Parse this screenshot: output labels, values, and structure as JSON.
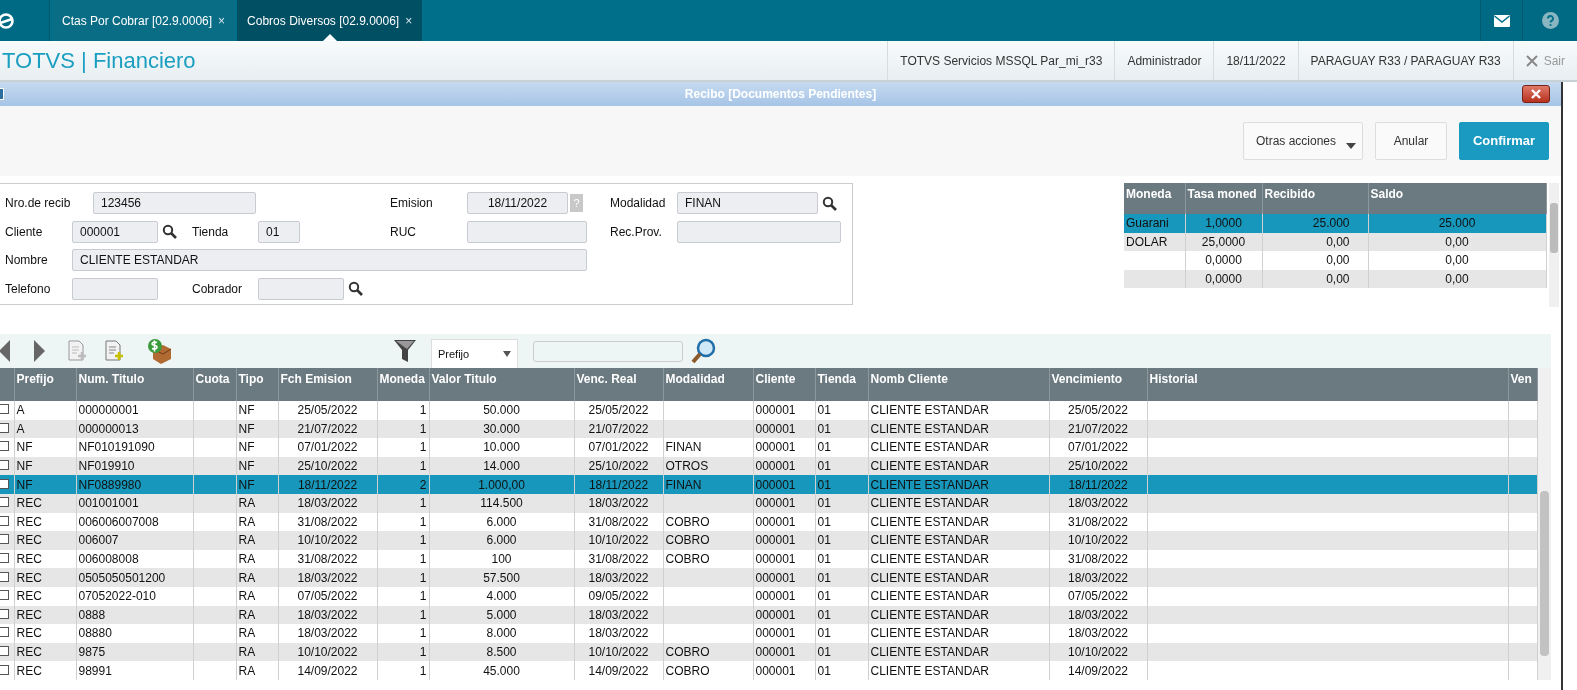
{
  "tabs": [
    {
      "label": "Ctas Por Cobrar [02.9.0006]",
      "close": "×",
      "selected": false
    },
    {
      "label": "Cobros Diversos [02.9.0006]",
      "close": "×",
      "selected": true
    }
  ],
  "app_title": "TOTVS | Financiero",
  "session_info": [
    "TOTVS Servicios MSSQL Par_mi_r33",
    "Administrador",
    "18/11/2022",
    "PARAGUAY R33 / PARAGUAY R33"
  ],
  "exit_label": "Sair",
  "dialog": {
    "title": "Recibo [Documentos Pendientes]"
  },
  "actions": [
    {
      "label": "Otras acciones",
      "kind": "menu"
    },
    {
      "label": "Anular",
      "kind": "plain"
    },
    {
      "label": "Confirmar",
      "kind": "primary"
    }
  ],
  "form": {
    "fields": [
      {
        "label": "Nro.de recib",
        "value": "123456",
        "lookup": false
      },
      {
        "label": "Emision",
        "value": "18/11/2022",
        "lookup": false,
        "help": "?"
      },
      {
        "label": "Modalidad",
        "value": "FINAN",
        "lookup": true
      },
      {
        "label": "Cliente",
        "value": "000001",
        "lookup": true
      },
      {
        "label": "Tienda",
        "value": "01",
        "lookup": false
      },
      {
        "label": "RUC",
        "lookup": false
      },
      {
        "label": "Rec.Prov.",
        "lookup": false
      },
      {
        "label": "Nombre",
        "value": "CLIENTE ESTANDAR",
        "lookup": false
      },
      {
        "label": "Telefono",
        "lookup": false
      },
      {
        "label": "Cobrador",
        "lookup": true
      }
    ]
  },
  "currency_table": {
    "columns": [
      "Moneda",
      "Tasa moned",
      "Recibido",
      "Saldo"
    ],
    "rows": [
      {
        "selected": true,
        "cells": [
          "Guarani",
          "1,0000",
          "25.000",
          "25.000"
        ]
      },
      {
        "selected": false,
        "cells": [
          "DOLAR",
          "25,0000",
          "0,00",
          "0,00"
        ]
      },
      {
        "selected": false,
        "cells": [
          null,
          "0,0000",
          "0,00",
          "0,00"
        ]
      },
      {
        "selected": false,
        "cells": [
          null,
          "0,0000",
          "0,00",
          "0,00"
        ]
      }
    ]
  },
  "toolbar": {
    "filter_field": {
      "value": "Prefijo"
    }
  },
  "table": {
    "columns": [
      "Prefijo",
      "Num. Titulo",
      "Cuota",
      "Tipo",
      "Fch Emision",
      "Moneda",
      "Valor Titulo",
      "Venc. Real",
      "Modalidad",
      "Cliente",
      "Tienda",
      "Nomb Cliente",
      "Vencimiento",
      "Historial",
      "Ven"
    ],
    "rows": [
      {
        "checked": false,
        "selected": false,
        "cells": [
          "A",
          "000000001",
          null,
          "NF",
          "25/05/2022",
          "1",
          "50.000",
          "25/05/2022",
          null,
          "000001",
          "01",
          "CLIENTE ESTANDAR",
          "25/05/2022"
        ]
      },
      {
        "checked": false,
        "selected": false,
        "cells": [
          "A",
          "000000013",
          null,
          "NF",
          "21/07/2022",
          "1",
          "30.000",
          "21/07/2022",
          null,
          "000001",
          "01",
          "CLIENTE ESTANDAR",
          "21/07/2022"
        ]
      },
      {
        "checked": false,
        "selected": false,
        "cells": [
          "NF",
          "NF010191090",
          null,
          "NF",
          "07/01/2022",
          "1",
          "10.000",
          "07/01/2022",
          "FINAN",
          "000001",
          "01",
          "CLIENTE ESTANDAR",
          "07/01/2022"
        ]
      },
      {
        "checked": false,
        "selected": false,
        "cells": [
          "NF",
          "NF019910",
          null,
          "NF",
          "25/10/2022",
          "1",
          "14.000",
          "25/10/2022",
          "OTROS",
          "000001",
          "01",
          "CLIENTE ESTANDAR",
          "25/10/2022"
        ]
      },
      {
        "checked": false,
        "selected": true,
        "cells": [
          "NF",
          "NF0889980",
          null,
          "NF",
          "18/11/2022",
          "2",
          "1.000,00",
          "18/11/2022",
          "FINAN",
          "000001",
          "01",
          "CLIENTE ESTANDAR",
          "18/11/2022"
        ]
      },
      {
        "checked": false,
        "selected": false,
        "cells": [
          "REC",
          "001001001",
          null,
          "RA",
          "18/03/2022",
          "1",
          "114.500",
          "18/03/2022",
          null,
          "000001",
          "01",
          "CLIENTE ESTANDAR",
          "18/03/2022"
        ]
      },
      {
        "checked": false,
        "selected": false,
        "cells": [
          "REC",
          "006006007008",
          null,
          "RA",
          "31/08/2022",
          "1",
          "6.000",
          "31/08/2022",
          "COBRO",
          "000001",
          "01",
          "CLIENTE ESTANDAR",
          "31/08/2022"
        ]
      },
      {
        "checked": false,
        "selected": false,
        "cells": [
          "REC",
          "006007",
          null,
          "RA",
          "10/10/2022",
          "1",
          "6.000",
          "10/10/2022",
          "COBRO",
          "000001",
          "01",
          "CLIENTE ESTANDAR",
          "10/10/2022"
        ]
      },
      {
        "checked": false,
        "selected": false,
        "cells": [
          "REC",
          "006008008",
          null,
          "RA",
          "31/08/2022",
          "1",
          "100",
          "31/08/2022",
          "COBRO",
          "000001",
          "01",
          "CLIENTE ESTANDAR",
          "31/08/2022"
        ]
      },
      {
        "checked": false,
        "selected": false,
        "cells": [
          "REC",
          "0505050501200",
          null,
          "RA",
          "18/03/2022",
          "1",
          "57.500",
          "18/03/2022",
          null,
          "000001",
          "01",
          "CLIENTE ESTANDAR",
          "18/03/2022"
        ]
      },
      {
        "checked": false,
        "selected": false,
        "cells": [
          "REC",
          "07052022-010",
          null,
          "RA",
          "07/05/2022",
          "1",
          "4.000",
          "09/05/2022",
          null,
          "000001",
          "01",
          "CLIENTE ESTANDAR",
          "07/05/2022"
        ]
      },
      {
        "checked": false,
        "selected": false,
        "cells": [
          "REC",
          "0888",
          null,
          "RA",
          "18/03/2022",
          "1",
          "5.000",
          "18/03/2022",
          null,
          "000001",
          "01",
          "CLIENTE ESTANDAR",
          "18/03/2022"
        ]
      },
      {
        "checked": false,
        "selected": false,
        "cells": [
          "REC",
          "08880",
          null,
          "RA",
          "18/03/2022",
          "1",
          "8.000",
          "18/03/2022",
          null,
          "000001",
          "01",
          "CLIENTE ESTANDAR",
          "18/03/2022"
        ]
      },
      {
        "checked": false,
        "selected": false,
        "cells": [
          "REC",
          "9875",
          null,
          "RA",
          "10/10/2022",
          "1",
          "8.500",
          "10/10/2022",
          "COBRO",
          "000001",
          "01",
          "CLIENTE ESTANDAR",
          "10/10/2022"
        ]
      },
      {
        "checked": false,
        "selected": false,
        "cells": [
          "REC",
          "98991",
          null,
          "RA",
          "14/09/2022",
          "1",
          "45.000",
          "14/09/2022",
          "COBRO",
          "000001",
          "01",
          "CLIENTE ESTANDAR",
          "14/09/2022"
        ]
      }
    ]
  }
}
